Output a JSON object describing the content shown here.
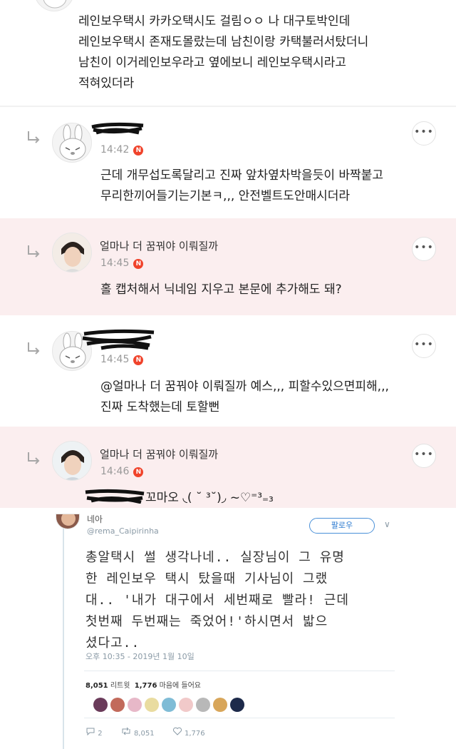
{
  "comments": [
    {
      "text_lines": [
        "레인보우택시 카카오택시도 걸림ㅇㅇ 나 대구토박인데",
        "레인보우택시 존재도몰랐는데 남친이랑 카택불러서탔더니",
        "남친이 이거레인보우라고 옆에보니 레인보우택시라고",
        "적혀있더라"
      ]
    },
    {
      "time": "14:42",
      "text_lines": [
        "근데 개무섭도록달리고 진짜 앞차옆차박을듯이 바짝붙고",
        "무리한끼어들기는기본ㅋ,,, 안전벨트도안매시더라"
      ]
    },
    {
      "nick": "얼마나 더 꿈꿔야 이뤄질까",
      "time": "14:45",
      "text_lines": [
        "홀 캡처해서 닉네임 지우고 본문에 추가해도 돼?"
      ]
    },
    {
      "time": "14:45",
      "mention": "@얼마나 더 꿈꿔야 이뤄질까",
      "text_first_rest": "  예스,,, 피할수있으면피해,,,",
      "text_second": "진짜 도착했는데 토할뻔"
    },
    {
      "nick": "얼마나 더 꿈꿔야 이뤄질까",
      "time": "14:46",
      "text": "꼬마오 ◟( ˘ ³˘)◞ ~♡⁼³₌₃"
    }
  ],
  "badge": "N",
  "more_label": "•••",
  "tweet": {
    "name": "네아",
    "handle": "@rema_Caipirinha",
    "follow_label": "팔로우",
    "chevron": "∨",
    "body_lines": [
      "총알택시 썰 생각나네.. 실장님이 그 유명",
      "한 레인보우 택시 탔을때 기사님이 그랬",
      "대.. '내가 대구에서 세번째로 빨라! 근데",
      "첫번째 두번째는 죽었어!'하시면서 밟으",
      "셨다고.."
    ],
    "timestamp": "오후 10:35 - 2019년 1월 10일",
    "retweets": "8,051",
    "retweets_label": "리트윗",
    "likes": "1,776",
    "likes_label": "마음에 들어요",
    "replies_count": "2",
    "retweet_count": "8,051",
    "like_count": "1,776",
    "liker_colors": [
      "#6a3b5a",
      "#c26a5b",
      "#e7b8c8",
      "#e9dca0",
      "#7fbcd6",
      "#f1c9c9",
      "#b8b8b8",
      "#d8a65a",
      "#1d2a4a"
    ]
  }
}
